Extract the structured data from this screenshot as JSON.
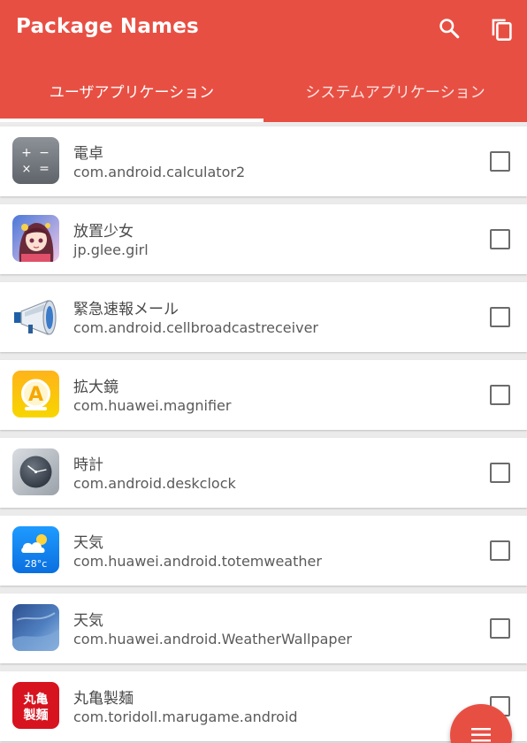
{
  "app_bar": {
    "title": "Package Names",
    "actions": [
      {
        "name": "search",
        "icon": "search-icon"
      },
      {
        "name": "copy",
        "icon": "copy-icon"
      }
    ],
    "color": "#e84f43"
  },
  "tabs": [
    {
      "label": "ユーザアプリケーション",
      "selected": true
    },
    {
      "label": "システムアプリケーション",
      "selected": false
    }
  ],
  "apps": [
    {
      "name": "電卓",
      "package": "com.android.calculator2",
      "icon": "calculator-icon",
      "checked": false
    },
    {
      "name": "放置少女",
      "package": "jp.glee.girl",
      "icon": "game-character-icon",
      "checked": false
    },
    {
      "name": "緊急速報メール",
      "package": "com.android.cellbroadcastreceiver",
      "icon": "megaphone-icon",
      "checked": false
    },
    {
      "name": "拡大鏡",
      "package": "com.huawei.magnifier",
      "icon": "magnifier-icon",
      "checked": false
    },
    {
      "name": "時計",
      "package": "com.android.deskclock",
      "icon": "clock-icon",
      "checked": false
    },
    {
      "name": "天気",
      "package": "com.huawei.android.totemweather",
      "icon": "weather-icon",
      "icon_text": "28°c",
      "checked": false
    },
    {
      "name": "天気",
      "package": "com.huawei.android.WeatherWallpaper",
      "icon": "weather-wallpaper-icon",
      "checked": false
    },
    {
      "name": "丸亀製麺",
      "package": "com.toridoll.marugame.android",
      "icon": "marugame-logo-icon",
      "icon_text": "丸亀製麺",
      "checked": false
    }
  ],
  "fab": {
    "icon": "menu-icon"
  }
}
